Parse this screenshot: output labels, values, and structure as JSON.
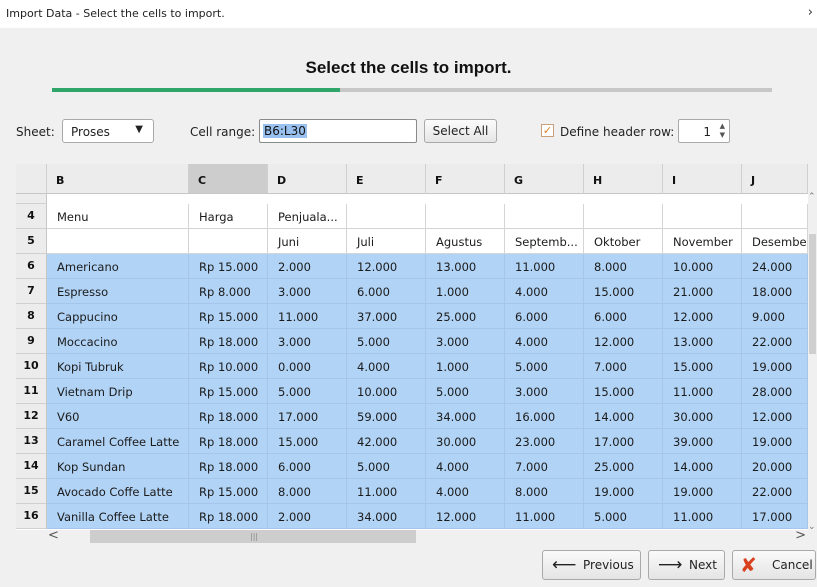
{
  "window": {
    "title": "Import Data - Select the cells to import.",
    "close_glyph": "›"
  },
  "heading": "Select the cells to import.",
  "progress": {
    "fraction": 0.4,
    "color": "#2fa56a"
  },
  "form": {
    "sheet_label": "Sheet:",
    "sheet_value": "Proses",
    "cell_range_label": "Cell range:",
    "cell_range_value": "B6:L30",
    "select_all_label": "Select All",
    "define_header_label": "Define header row:",
    "define_header_checked": true,
    "header_row_value": "1"
  },
  "grid": {
    "columns": [
      "B",
      "C",
      "D",
      "E",
      "F",
      "G",
      "H",
      "I",
      "J"
    ],
    "active_column": "C",
    "rows": [
      {
        "num": "4",
        "selected": false,
        "cells": [
          "Menu",
          "Harga",
          "Penjuala...",
          "",
          "",
          "",
          "",
          "",
          ""
        ]
      },
      {
        "num": "5",
        "selected": false,
        "cells": [
          "",
          "",
          "Juni",
          "Juli",
          "Agustus",
          "Septemb...",
          "Oktober",
          "November",
          "Desembe"
        ]
      },
      {
        "num": "6",
        "selected": true,
        "cells": [
          "Americano",
          "Rp 15.000",
          "2.000",
          "12.000",
          "13.000",
          "11.000",
          "8.000",
          "10.000",
          "24.000"
        ]
      },
      {
        "num": "7",
        "selected": true,
        "cells": [
          "Espresso",
          "Rp 8.000",
          "3.000",
          "6.000",
          "1.000",
          "4.000",
          "15.000",
          "21.000",
          "18.000"
        ]
      },
      {
        "num": "8",
        "selected": true,
        "cells": [
          "Cappucino",
          "Rp 15.000",
          "11.000",
          "37.000",
          "25.000",
          "6.000",
          "6.000",
          "12.000",
          "9.000"
        ]
      },
      {
        "num": "9",
        "selected": true,
        "cells": [
          "Moccacino",
          "Rp 18.000",
          "3.000",
          "5.000",
          "3.000",
          "4.000",
          "12.000",
          "13.000",
          "22.000"
        ]
      },
      {
        "num": "10",
        "selected": true,
        "cells": [
          "Kopi Tubruk",
          "Rp 10.000",
          "0.000",
          "4.000",
          "1.000",
          "5.000",
          "7.000",
          "15.000",
          "19.000"
        ]
      },
      {
        "num": "11",
        "selected": true,
        "cells": [
          "Vietnam Drip",
          "Rp 15.000",
          "5.000",
          "10.000",
          "5.000",
          "3.000",
          "15.000",
          "11.000",
          "28.000"
        ]
      },
      {
        "num": "12",
        "selected": true,
        "cells": [
          "V60",
          "Rp 18.000",
          "17.000",
          "59.000",
          "34.000",
          "16.000",
          "14.000",
          "30.000",
          "12.000"
        ]
      },
      {
        "num": "13",
        "selected": true,
        "cells": [
          "Caramel Coffee Latte",
          "Rp 18.000",
          "15.000",
          "42.000",
          "30.000",
          "23.000",
          "17.000",
          "39.000",
          "19.000"
        ]
      },
      {
        "num": "14",
        "selected": true,
        "cells": [
          "Kop Sundan",
          "Rp 18.000",
          "6.000",
          "5.000",
          "4.000",
          "7.000",
          "25.000",
          "14.000",
          "20.000"
        ]
      },
      {
        "num": "15",
        "selected": true,
        "cells": [
          "Avocado Coffe Latte",
          "Rp 15.000",
          "8.000",
          "11.000",
          "4.000",
          "8.000",
          "19.000",
          "19.000",
          "22.000"
        ]
      },
      {
        "num": "16",
        "selected": true,
        "cells": [
          "Vanilla Coffee Latte",
          "Rp 18.000",
          "2.000",
          "34.000",
          "12.000",
          "11.000",
          "5.000",
          "11.000",
          "17.000"
        ]
      }
    ]
  },
  "nav": {
    "previous_label": "Previous",
    "next_label": "Next",
    "cancel_label": "Cancel"
  }
}
